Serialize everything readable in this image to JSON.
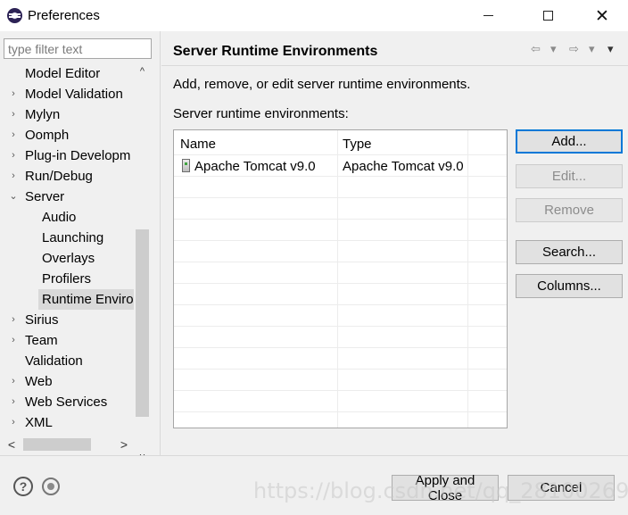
{
  "window": {
    "title": "Preferences",
    "minimize_icon": "minimize-icon",
    "maximize_icon": "maximize-icon",
    "close_glyph": "✕"
  },
  "filter": {
    "placeholder": "type filter text",
    "value": ""
  },
  "tree": {
    "items": [
      {
        "label": "Model Editor",
        "twisty": "",
        "level": 0
      },
      {
        "label": "Model Validation",
        "twisty": "›",
        "level": 0
      },
      {
        "label": "Mylyn",
        "twisty": "›",
        "level": 0
      },
      {
        "label": "Oomph",
        "twisty": "›",
        "level": 0
      },
      {
        "label": "Plug-in Developm",
        "twisty": "›",
        "level": 0
      },
      {
        "label": "Run/Debug",
        "twisty": "›",
        "level": 0
      },
      {
        "label": "Server",
        "twisty": "⌄",
        "level": 0
      },
      {
        "label": "Audio",
        "twisty": "",
        "level": 1
      },
      {
        "label": "Launching",
        "twisty": "",
        "level": 1
      },
      {
        "label": "Overlays",
        "twisty": "",
        "level": 1
      },
      {
        "label": "Profilers",
        "twisty": "",
        "level": 1
      },
      {
        "label": "Runtime Environ",
        "twisty": "",
        "level": 1,
        "selected": true
      },
      {
        "label": "Sirius",
        "twisty": "›",
        "level": 0
      },
      {
        "label": "Team",
        "twisty": "›",
        "level": 0
      },
      {
        "label": "Validation",
        "twisty": "",
        "level": 0
      },
      {
        "label": "Web",
        "twisty": "›",
        "level": 0
      },
      {
        "label": "Web Services",
        "twisty": "›",
        "level": 0
      },
      {
        "label": "XML",
        "twisty": "›",
        "level": 0
      }
    ]
  },
  "scroll": {
    "up": "^",
    "down": "v",
    "left": "<",
    "right": ">"
  },
  "page": {
    "title": "Server Runtime Environments",
    "description": "Add, remove, or edit server runtime environments.",
    "list_label": "Server runtime environments:",
    "nav": {
      "back": "⇦",
      "back_menu": "▾",
      "forward": "⇨",
      "forward_menu": "▾",
      "view_menu": "▾"
    }
  },
  "table": {
    "columns": [
      "Name",
      "Type"
    ],
    "rows": [
      {
        "name": "Apache Tomcat v9.0",
        "type": "Apache Tomcat v9.0",
        "icon": "server-icon"
      }
    ]
  },
  "buttons": {
    "add": "Add...",
    "edit": "Edit...",
    "remove": "Remove",
    "search": "Search...",
    "columns": "Columns..."
  },
  "footer": {
    "help_glyph": "?",
    "apply_close": "Apply and Close",
    "cancel": "Cancel",
    "watermark": "https://blog.csdn.net/qq_28100269"
  }
}
